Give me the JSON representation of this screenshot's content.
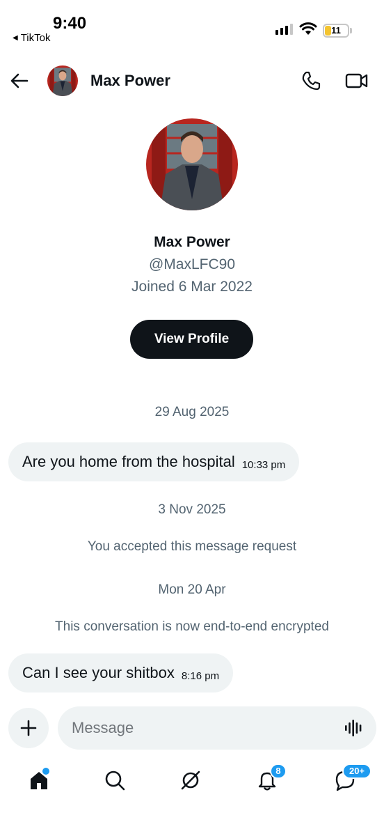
{
  "status_bar": {
    "time": "9:40",
    "back_app": "TikTok",
    "battery": "11"
  },
  "header": {
    "contact_name": "Max Power"
  },
  "profile": {
    "name": "Max Power",
    "handle": "@MaxLFC90",
    "joined": "Joined 6 Mar 2022",
    "view_profile_label": "View Profile"
  },
  "conversation": {
    "date_1": "29 Aug 2025",
    "message_1": {
      "text": "Are you home from the hospital",
      "time": "10:33 pm"
    },
    "date_2": "3 Nov 2025",
    "system_1": "You accepted this message request",
    "date_3": "Mon 20 Apr",
    "system_2": "This conversation is now end-to-end encrypted",
    "message_2": {
      "text": "Can I see your shitbox",
      "time": "8:16 pm"
    }
  },
  "composer": {
    "placeholder": "Message"
  },
  "bottom_nav": {
    "notifications_badge": "8",
    "messages_badge": "20+"
  },
  "colors": {
    "accent": "#1d9bf0",
    "bubble": "#eff3f4",
    "muted_text": "#536471",
    "button_dark": "#0f1419"
  }
}
